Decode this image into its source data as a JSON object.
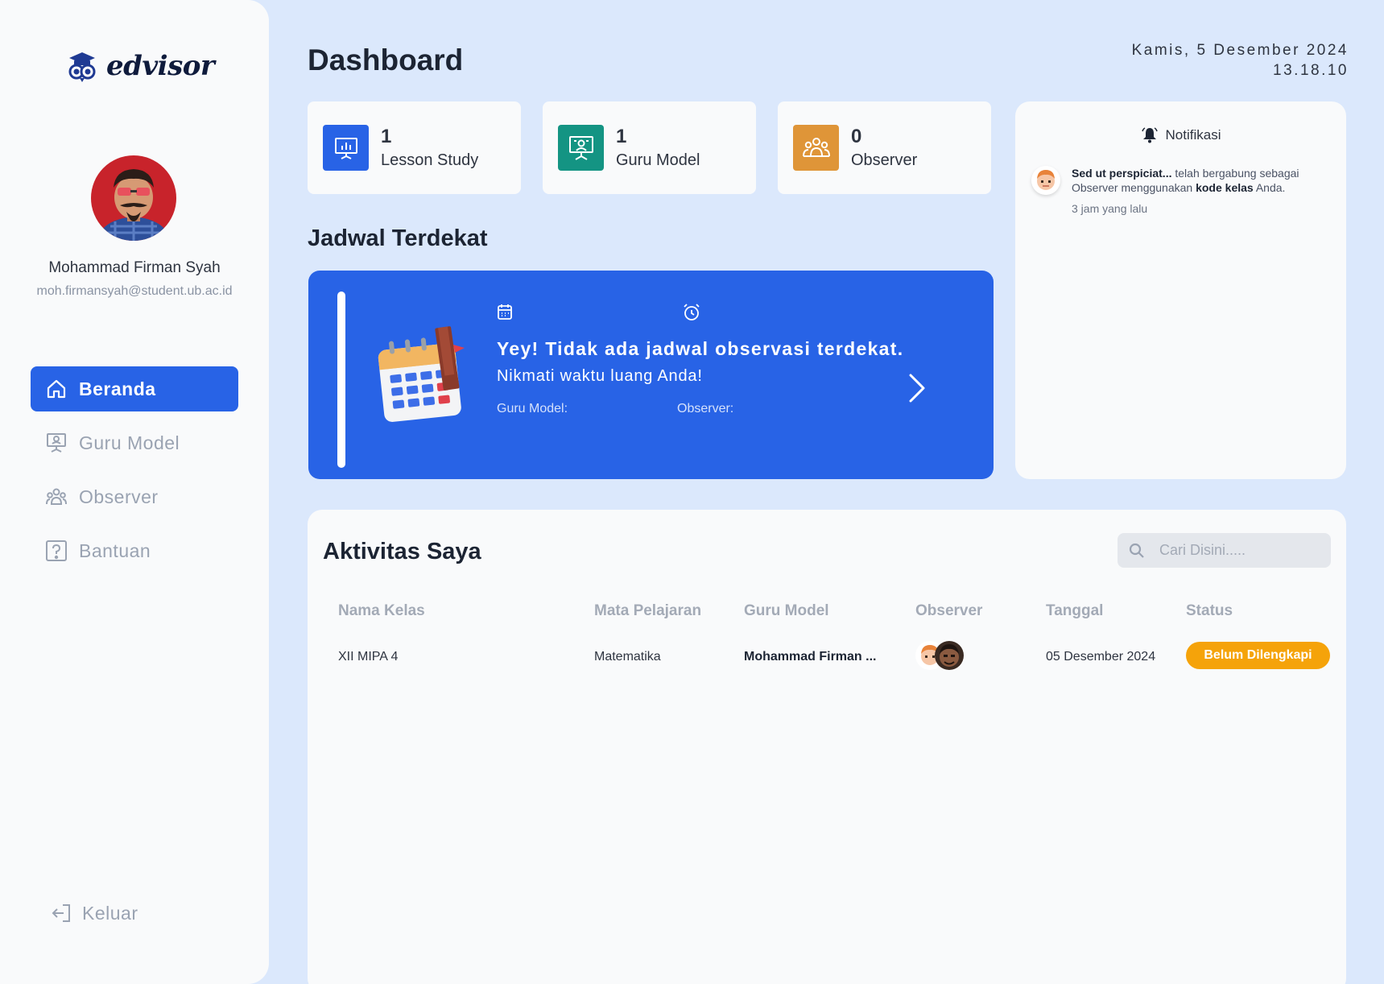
{
  "app": {
    "logo_text": "edvisor"
  },
  "user": {
    "name": "Mohammad Firman Syah",
    "email": "moh.firmansyah@student.ub.ac.id"
  },
  "nav": {
    "items": [
      {
        "label": "Beranda",
        "icon": "home-icon",
        "active": true
      },
      {
        "label": "Guru Model",
        "icon": "presentation-icon",
        "active": false
      },
      {
        "label": "Observer",
        "icon": "group-icon",
        "active": false
      },
      {
        "label": "Bantuan",
        "icon": "help-icon",
        "active": false
      }
    ],
    "logout_label": "Keluar"
  },
  "header": {
    "title": "Dashboard",
    "date": "Kamis, 5 Desember 2024",
    "time": "13.18.10"
  },
  "stats": [
    {
      "value": "1",
      "label": "Lesson Study",
      "color": "#2863e6",
      "icon": "chart-board-icon"
    },
    {
      "value": "1",
      "label": "Guru Model",
      "color": "#149483",
      "icon": "teacher-board-icon"
    },
    {
      "value": "0",
      "label": "Observer",
      "color": "#df9538",
      "icon": "people-icon"
    }
  ],
  "notifications": {
    "title": "Notifikasi",
    "items": [
      {
        "name": "Sed ut perspiciat...",
        "text_1": " telah bergabung sebagai Observer menggunakan ",
        "highlight": "kode kelas",
        "text_2": " Anda.",
        "time": "3 jam yang lalu"
      }
    ]
  },
  "schedule": {
    "section_title": "Jadwal Terdekat",
    "title": "Yey! Tidak ada jadwal observasi terdekat.",
    "subtitle": "Nikmati waktu luang Anda!",
    "guru_label": "Guru Model:",
    "observer_label": "Observer:"
  },
  "activity": {
    "title": "Aktivitas Saya",
    "search_placeholder": "Cari Disini.....",
    "columns": [
      "Nama Kelas",
      "Mata Pelajaran",
      "Guru Model",
      "Observer",
      "Tanggal",
      "Status"
    ],
    "rows": [
      {
        "kelas": "XII MIPA 4",
        "mapel": "Matematika",
        "guru": "Mohammad Firman ...",
        "tanggal": "05 Desember 2024",
        "status": "Belum Dilengkapi"
      }
    ]
  },
  "colors": {
    "primary": "#2863e6",
    "teal": "#149483",
    "orange": "#df9538",
    "status_warning": "#f5a30a",
    "background": "#dbe8fc"
  }
}
